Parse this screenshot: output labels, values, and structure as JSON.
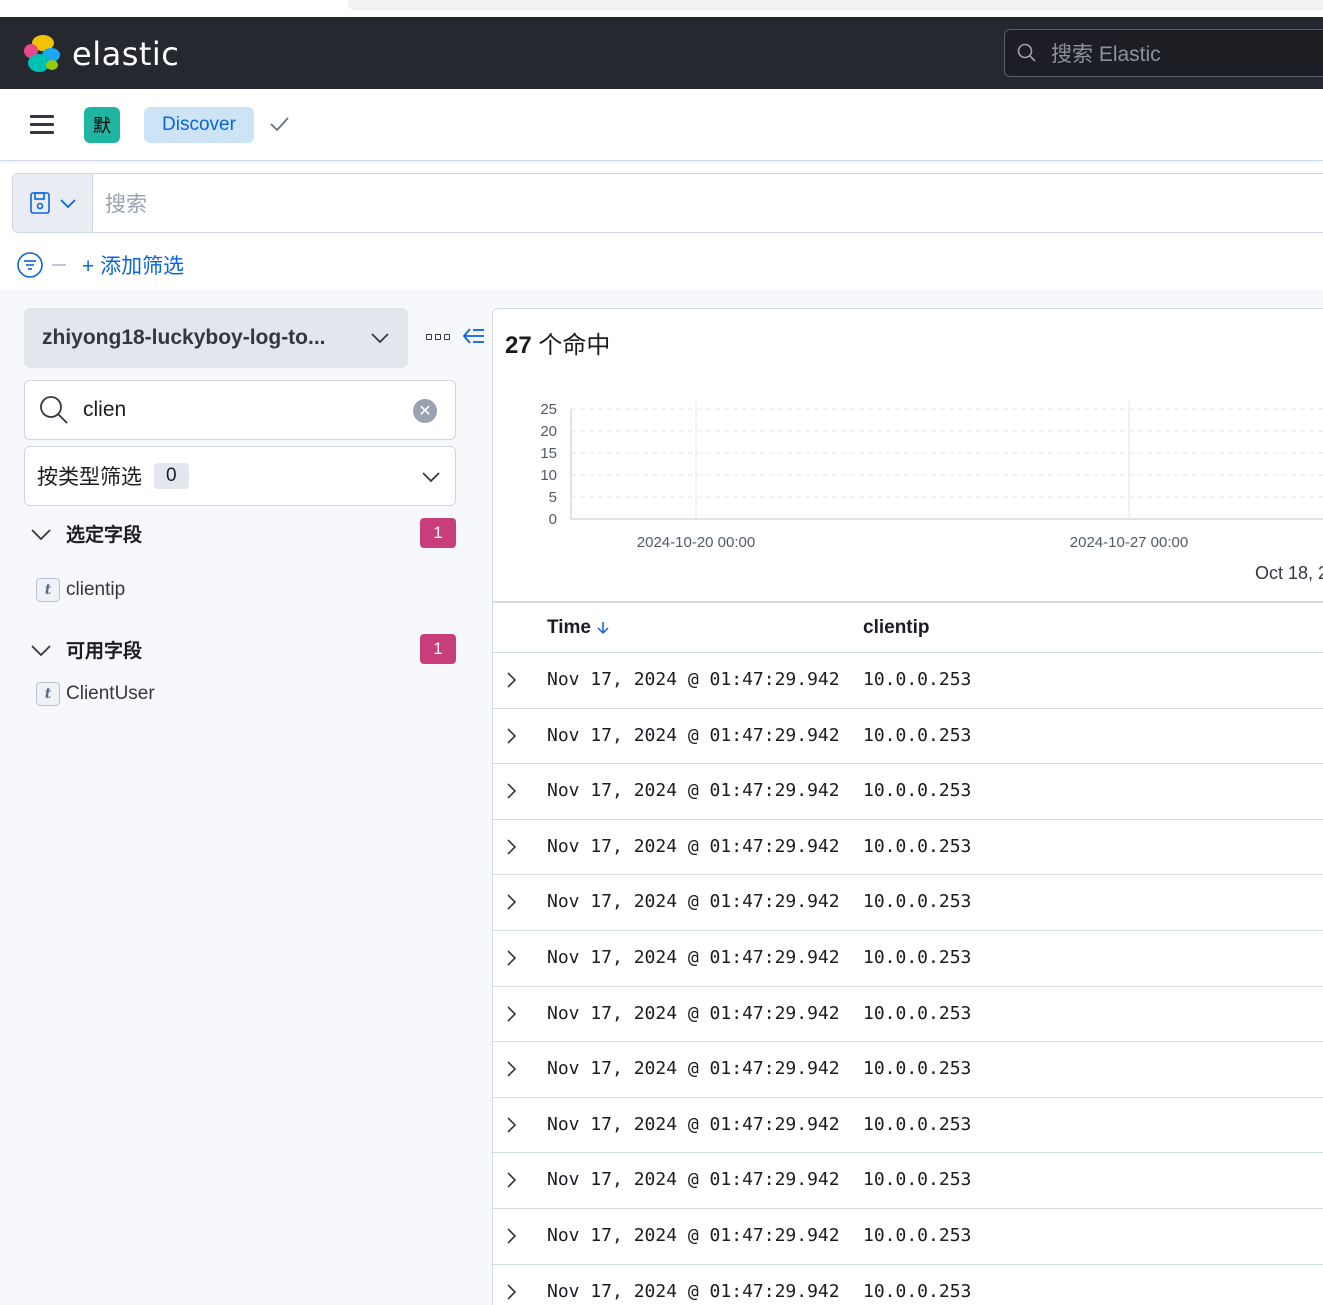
{
  "brand": {
    "name": "elastic"
  },
  "header": {
    "search_placeholder": "搜索 Elastic"
  },
  "nav": {
    "space_initial": "默",
    "breadcrumb": "Discover"
  },
  "query": {
    "placeholder": "搜索"
  },
  "filters": {
    "add_label": "+ 添加筛选"
  },
  "sidebar": {
    "index_pattern": "zhiyong18-luckyboy-log-to...",
    "field_search_value": "clien",
    "type_filter_label": "按类型筛选",
    "type_filter_count": "0",
    "selected_section": {
      "label": "选定字段",
      "count": "1",
      "fields": [
        "clientip"
      ]
    },
    "available_section": {
      "label": "可用字段",
      "count": "1",
      "fields": [
        "ClientUser"
      ]
    }
  },
  "results": {
    "hit_count": "27",
    "hit_suffix": " 个命中",
    "footer_time": "Oct 18, 2",
    "columns": {
      "time": "Time",
      "field": "clientip"
    },
    "rows": [
      {
        "time": "Nov 17, 2024 @ 01:47:29.942",
        "clientip": "10.0.0.253"
      },
      {
        "time": "Nov 17, 2024 @ 01:47:29.942",
        "clientip": "10.0.0.253"
      },
      {
        "time": "Nov 17, 2024 @ 01:47:29.942",
        "clientip": "10.0.0.253"
      },
      {
        "time": "Nov 17, 2024 @ 01:47:29.942",
        "clientip": "10.0.0.253"
      },
      {
        "time": "Nov 17, 2024 @ 01:47:29.942",
        "clientip": "10.0.0.253"
      },
      {
        "time": "Nov 17, 2024 @ 01:47:29.942",
        "clientip": "10.0.0.253"
      },
      {
        "time": "Nov 17, 2024 @ 01:47:29.942",
        "clientip": "10.0.0.253"
      },
      {
        "time": "Nov 17, 2024 @ 01:47:29.942",
        "clientip": "10.0.0.253"
      },
      {
        "time": "Nov 17, 2024 @ 01:47:29.942",
        "clientip": "10.0.0.253"
      },
      {
        "time": "Nov 17, 2024 @ 01:47:29.942",
        "clientip": "10.0.0.253"
      },
      {
        "time": "Nov 17, 2024 @ 01:47:29.942",
        "clientip": "10.0.0.253"
      },
      {
        "time": "Nov 17, 2024 @ 01:47:29.942",
        "clientip": "10.0.0.253"
      }
    ]
  },
  "chart_data": {
    "type": "bar",
    "y_ticks": [
      "25",
      "20",
      "15",
      "10",
      "5",
      "0"
    ],
    "ylim": [
      0,
      25
    ],
    "x_tick_labels": [
      "2024-10-20 00:00",
      "2024-10-27 00:00"
    ],
    "grid": true,
    "series": []
  },
  "colors": {
    "header_bg": "#25282f",
    "accent": "#0b64dd",
    "pill": "#c83e7a",
    "space_badge": "#1fb5a3"
  }
}
